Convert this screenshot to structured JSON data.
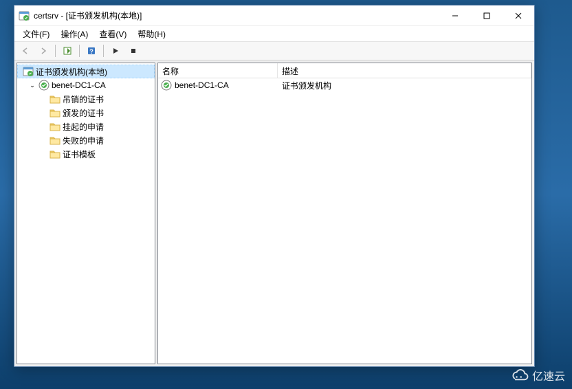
{
  "title": "certsrv - [证书颁发机构(本地)]",
  "menu": {
    "file": "文件(F)",
    "action": "操作(A)",
    "view": "查看(V)",
    "help": "帮助(H)"
  },
  "tree": {
    "root": "证书颁发机构(本地)",
    "ca": "benet-DC1-CA",
    "children": {
      "revoked": "吊销的证书",
      "issued": "颁发的证书",
      "pending": "挂起的申请",
      "failed": "失败的申请",
      "templates": "证书模板"
    }
  },
  "columns": {
    "name": "名称",
    "desc": "描述"
  },
  "rows": [
    {
      "name": "benet-DC1-CA",
      "desc": "证书颁发机构"
    }
  ],
  "watermark": "亿速云"
}
